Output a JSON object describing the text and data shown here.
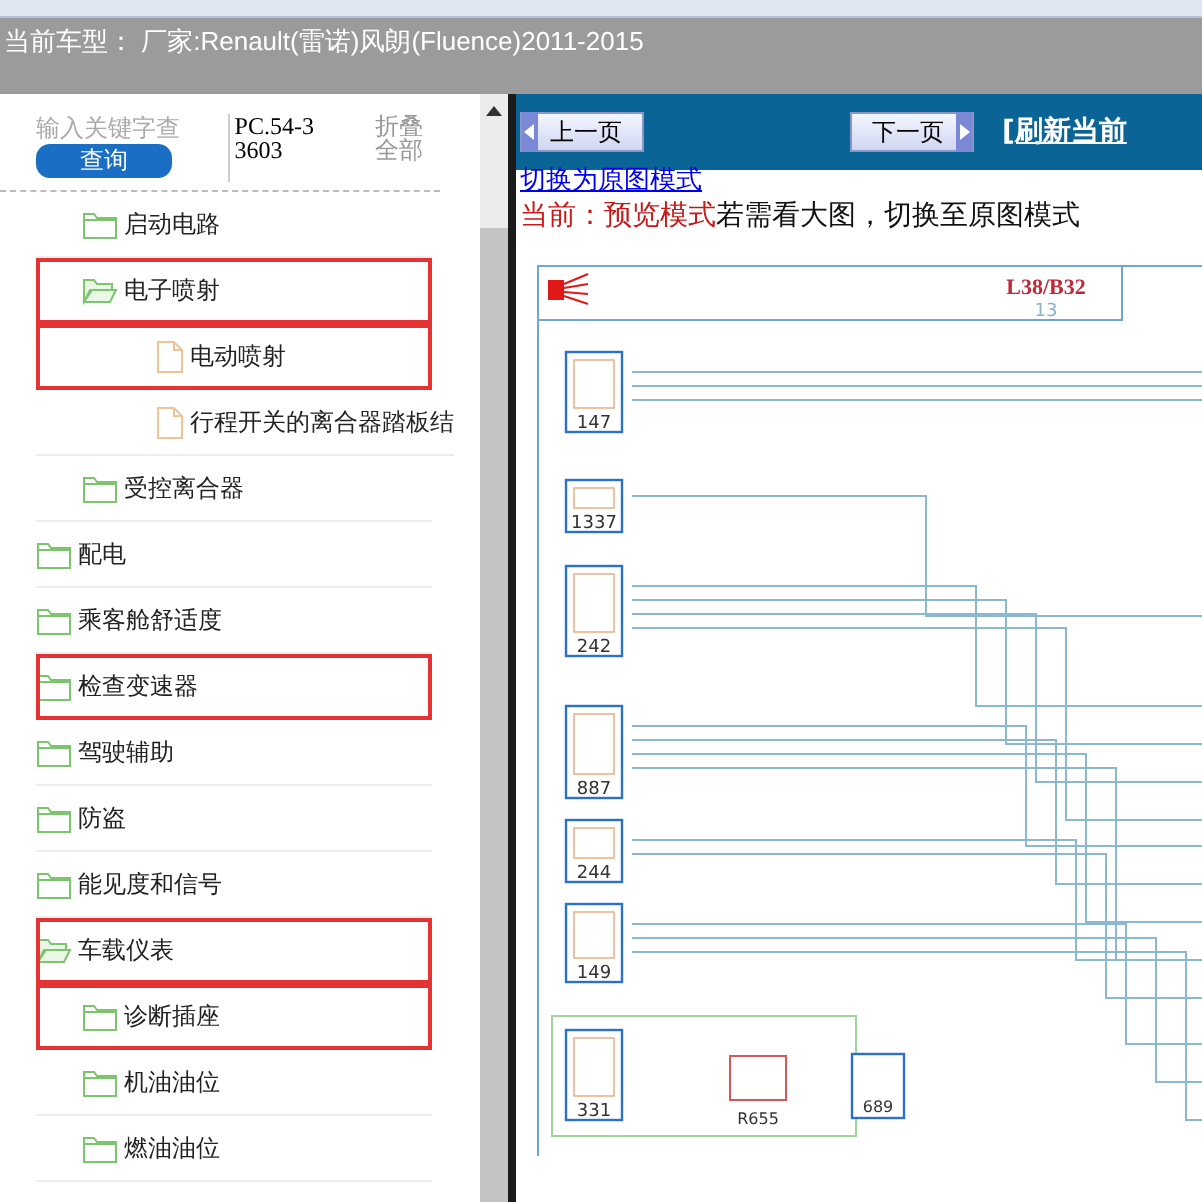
{
  "header": {
    "vehicle": "当前车型： 厂家:Renault(雷诺)风朗(Fluence)2011-2015"
  },
  "sidebar": {
    "search": {
      "placeholder": "输入关键字查"
    },
    "search_button": "查询",
    "code": "PC.54-33603",
    "collapse_all": "折叠全部",
    "tree": {
      "continued_children": [
        {
          "label": "启动电路",
          "kind": "folder",
          "expanded": false,
          "highlighted": false
        },
        {
          "label": "电子喷射",
          "kind": "folder",
          "expanded": true,
          "highlighted": true,
          "children": [
            {
              "label": "电动喷射",
              "kind": "file",
              "highlighted": true
            },
            {
              "label": "行程开关的离合器踏板结",
              "kind": "file",
              "highlighted": false
            }
          ]
        },
        {
          "label": "受控离合器",
          "kind": "folder",
          "expanded": false,
          "highlighted": false
        }
      ],
      "items": [
        {
          "label": "配电",
          "kind": "folder",
          "expanded": false,
          "highlighted": false
        },
        {
          "label": "乘客舱舒适度",
          "kind": "folder",
          "expanded": false,
          "highlighted": false
        },
        {
          "label": "检查变速器",
          "kind": "folder",
          "expanded": false,
          "highlighted": true
        },
        {
          "label": "驾驶辅助",
          "kind": "folder",
          "expanded": false,
          "highlighted": false
        },
        {
          "label": "防盗",
          "kind": "folder",
          "expanded": false,
          "highlighted": false
        },
        {
          "label": "能见度和信号",
          "kind": "folder",
          "expanded": false,
          "highlighted": false
        },
        {
          "label": "车载仪表",
          "kind": "folder",
          "expanded": true,
          "highlighted": true,
          "children": [
            {
              "label": "诊断插座",
              "kind": "folder",
              "expanded": false,
              "highlighted": true
            },
            {
              "label": "机油油位",
              "kind": "folder",
              "expanded": false,
              "highlighted": false
            },
            {
              "label": "燃油油位",
              "kind": "folder",
              "expanded": false,
              "highlighted": false
            }
          ]
        }
      ]
    }
  },
  "toolbar": {
    "prev": "上一页",
    "next": "下一页",
    "refresh": "[刷新当前"
  },
  "view": {
    "switch_link": "切换为原图模式",
    "current_mode": "当前：预览模式",
    "hint": "若需看大图，切换至原图模式"
  },
  "diagram": {
    "sheet": "L38/B32",
    "page": "13",
    "components": [
      "147",
      "1337",
      "242",
      "887",
      "244",
      "149",
      "331"
    ],
    "relay": "R655",
    "module": "689"
  }
}
